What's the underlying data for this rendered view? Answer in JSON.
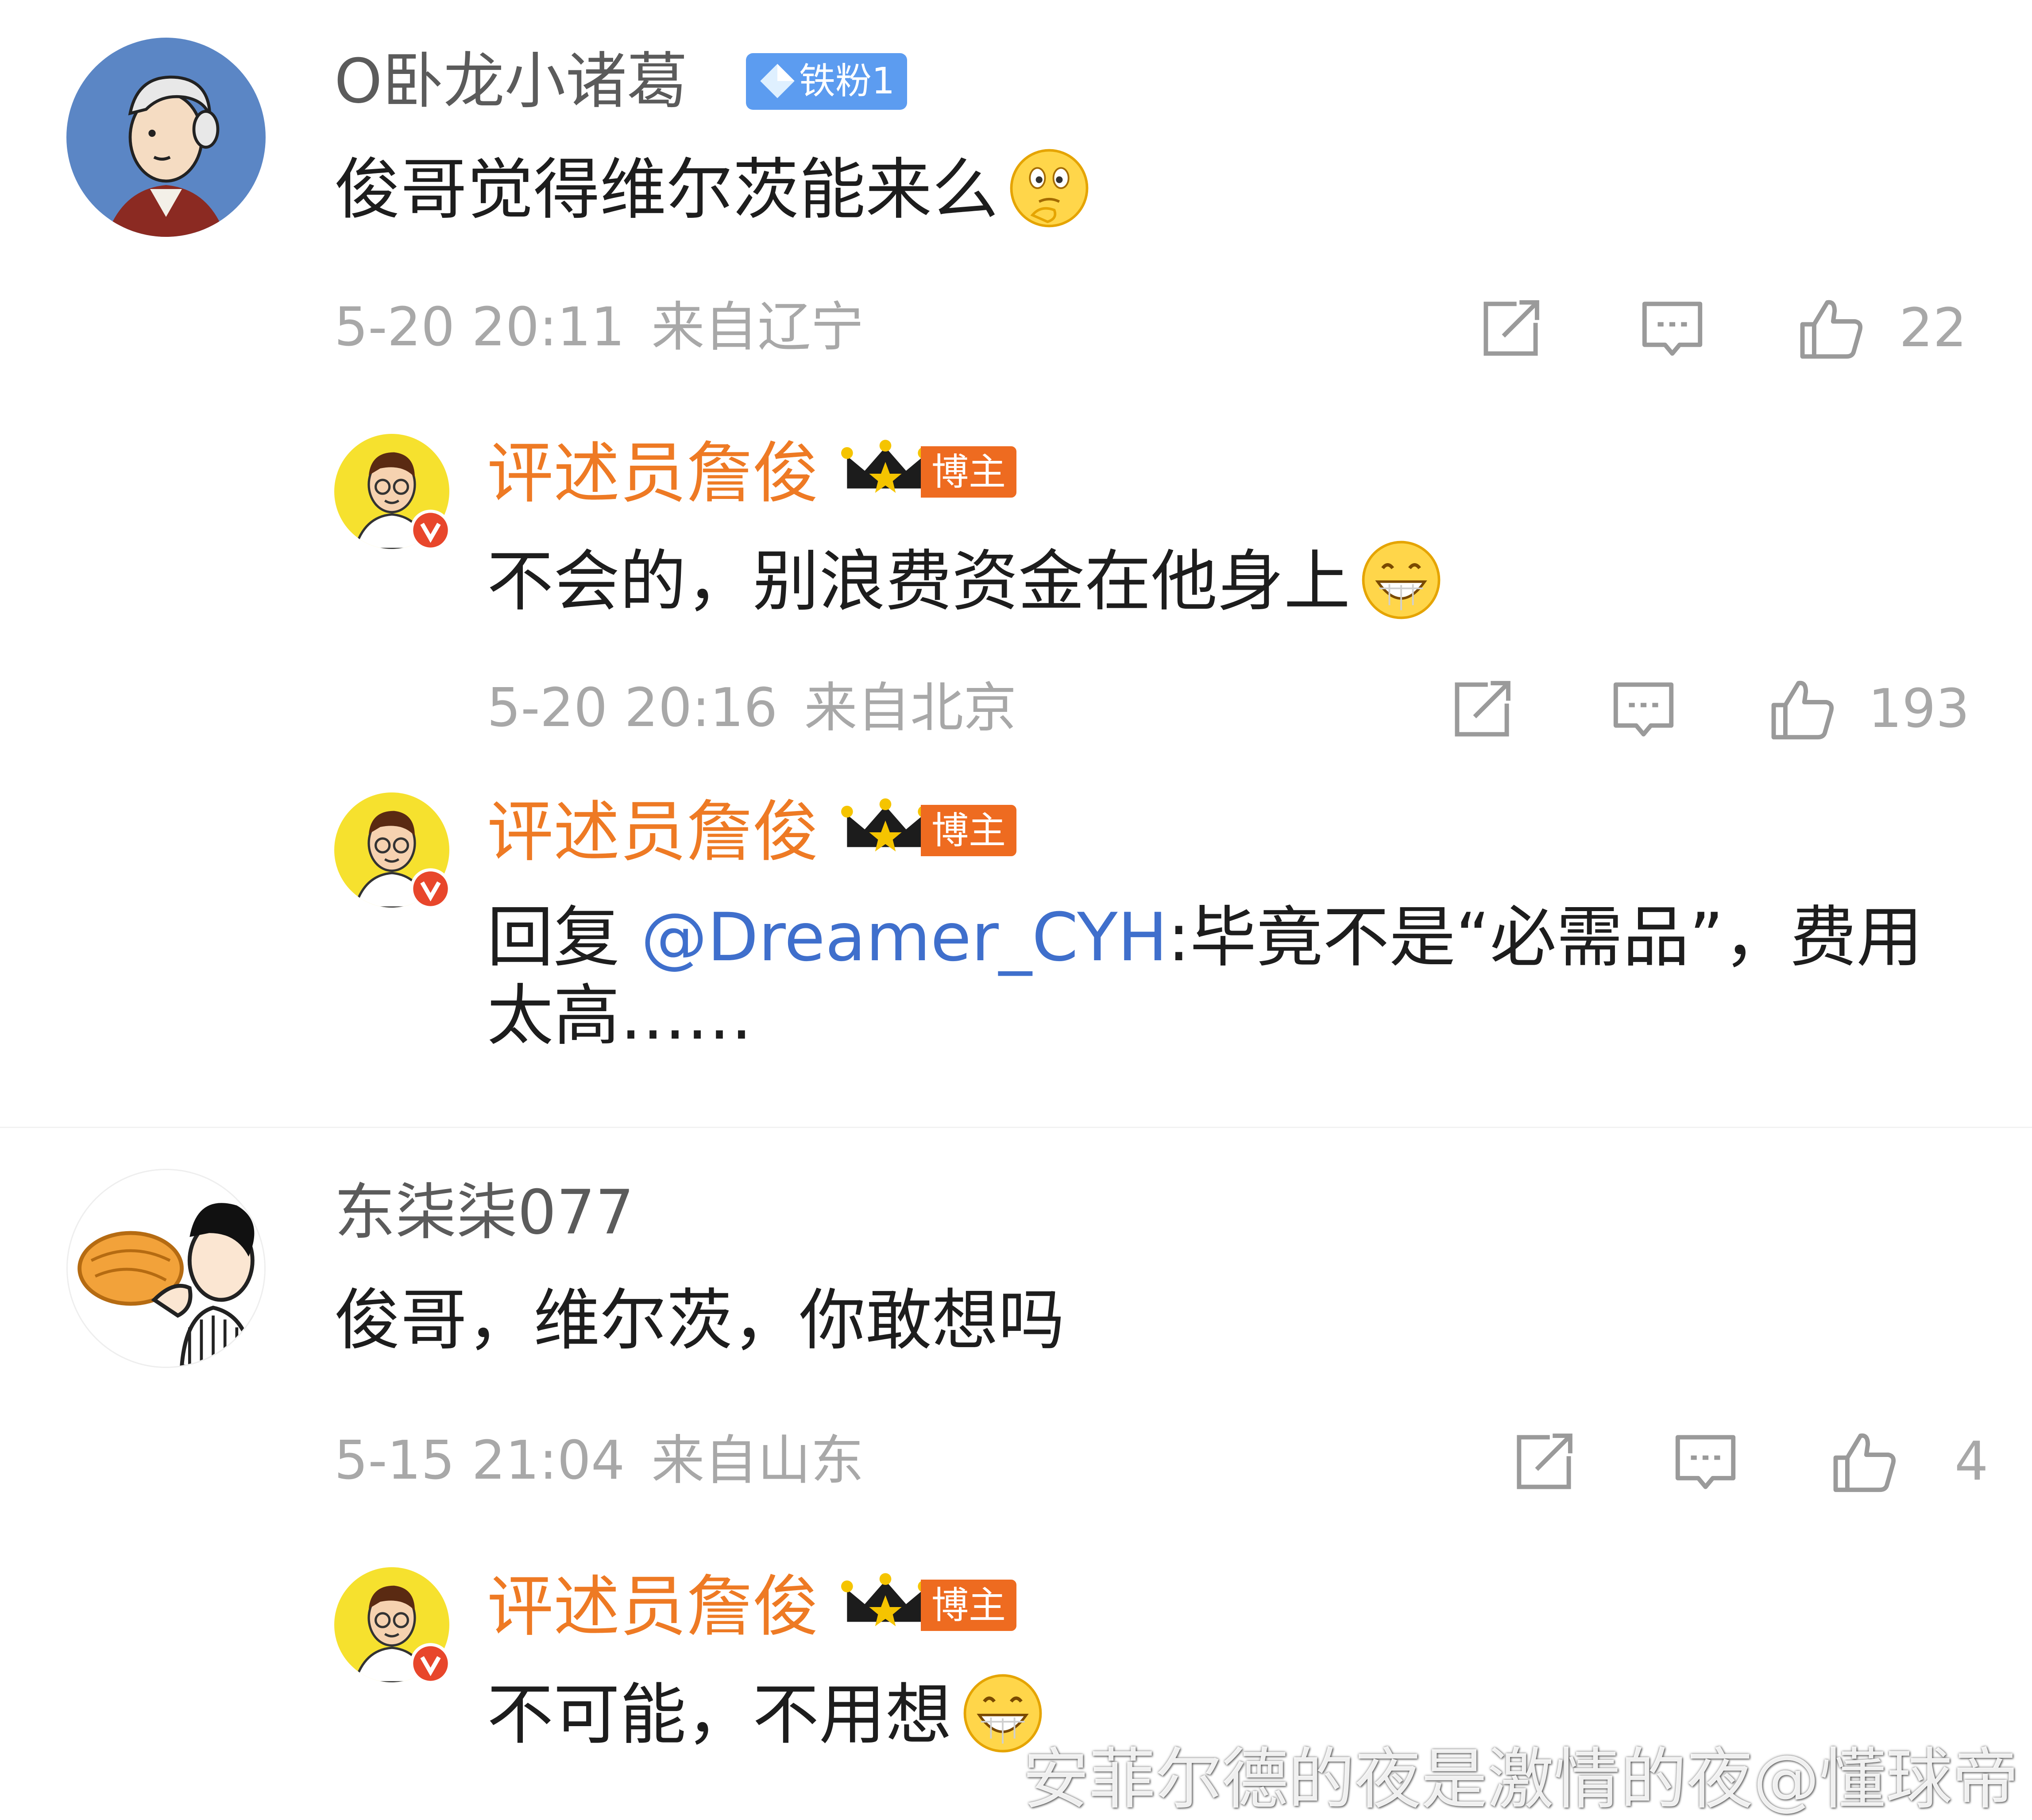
{
  "threads": [
    {
      "comment": {
        "username": "O卧龙小诸葛",
        "badge": "铁粉1",
        "text": "俊哥觉得维尔茨能来么",
        "emoji": "thinking-emoji",
        "time": "5-20 20:11",
        "location": "来自辽宁",
        "likes": "22"
      },
      "replies": [
        {
          "username": "评述员詹俊",
          "badge": "博主",
          "text": "不会的，别浪费资金在他身上",
          "emoji": "grin-emoji",
          "time": "5-20 20:16",
          "location": "来自北京",
          "likes": "193"
        },
        {
          "username": "评述员詹俊",
          "badge": "博主",
          "prefix": "回复 ",
          "mention": "@Dreamer_CYH",
          "text": ":毕竟不是“必需品”，费用太高……"
        }
      ]
    },
    {
      "comment": {
        "username": "东柒柒077",
        "text": "俊哥，维尔茨，你敢想吗",
        "time": "5-15 21:04",
        "location": "来自山东",
        "likes": "4"
      },
      "replies": [
        {
          "username": "评述员詹俊",
          "badge": "博主",
          "text": "不可能，不用想",
          "emoji": "grin-emoji"
        }
      ]
    }
  ],
  "watermark": "安菲尔德的夜是激情的夜@懂球帝",
  "colors": {
    "reply_name": "#ee7a24",
    "mention": "#3f6fcc",
    "meta_gray": "#a8a8a8",
    "fan_badge": "#5c9cf0",
    "blogger_badge": "#ee6b20"
  }
}
